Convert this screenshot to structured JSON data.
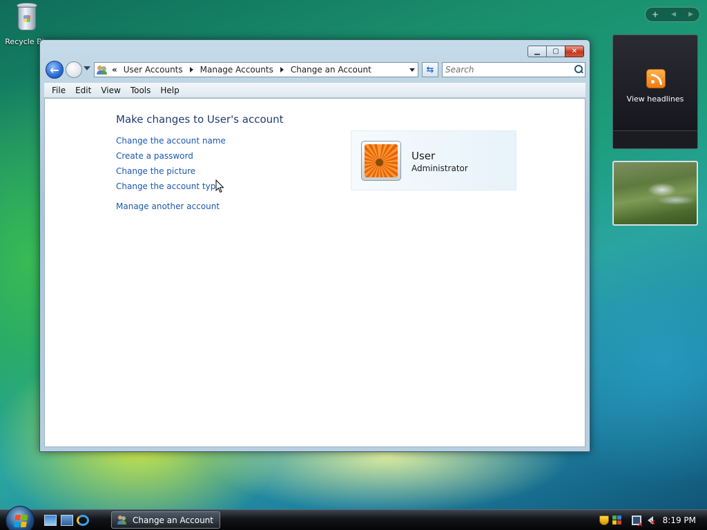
{
  "desktop": {
    "recycle_bin_label": "Recycle Bin"
  },
  "gadgets": {
    "feed_label": "View headlines"
  },
  "window": {
    "address": {
      "crumbs": [
        "User Accounts",
        "Manage Accounts",
        "Change an Account"
      ]
    },
    "search_placeholder": "Search",
    "menu": [
      "File",
      "Edit",
      "View",
      "Tools",
      "Help"
    ],
    "heading": "Make changes to User's account",
    "links": [
      "Change the account name",
      "Create a password",
      "Change the picture",
      "Change the account type",
      "Manage another account"
    ],
    "account": {
      "name": "User",
      "type": "Administrator"
    },
    "caption": {
      "minimize": "▁",
      "maximize": "▢",
      "close": "✕"
    }
  },
  "taskbar": {
    "task_label": "Change an Account",
    "clock": "8:19 PM"
  },
  "colors": {
    "link": "#1a58ae",
    "heading": "#1e3b70"
  },
  "icons": [
    "recycle-bin-icon",
    "rss-icon",
    "back-arrow-icon",
    "forward-arrow-icon",
    "user-accounts-icon",
    "refresh-icon",
    "search-icon",
    "user-picture-flower",
    "start-orb",
    "show-desktop-icon",
    "switch-windows-icon",
    "internet-explorer-icon",
    "windows-defender-icon",
    "security-center-icon",
    "network-icon",
    "volume-muted-icon"
  ]
}
